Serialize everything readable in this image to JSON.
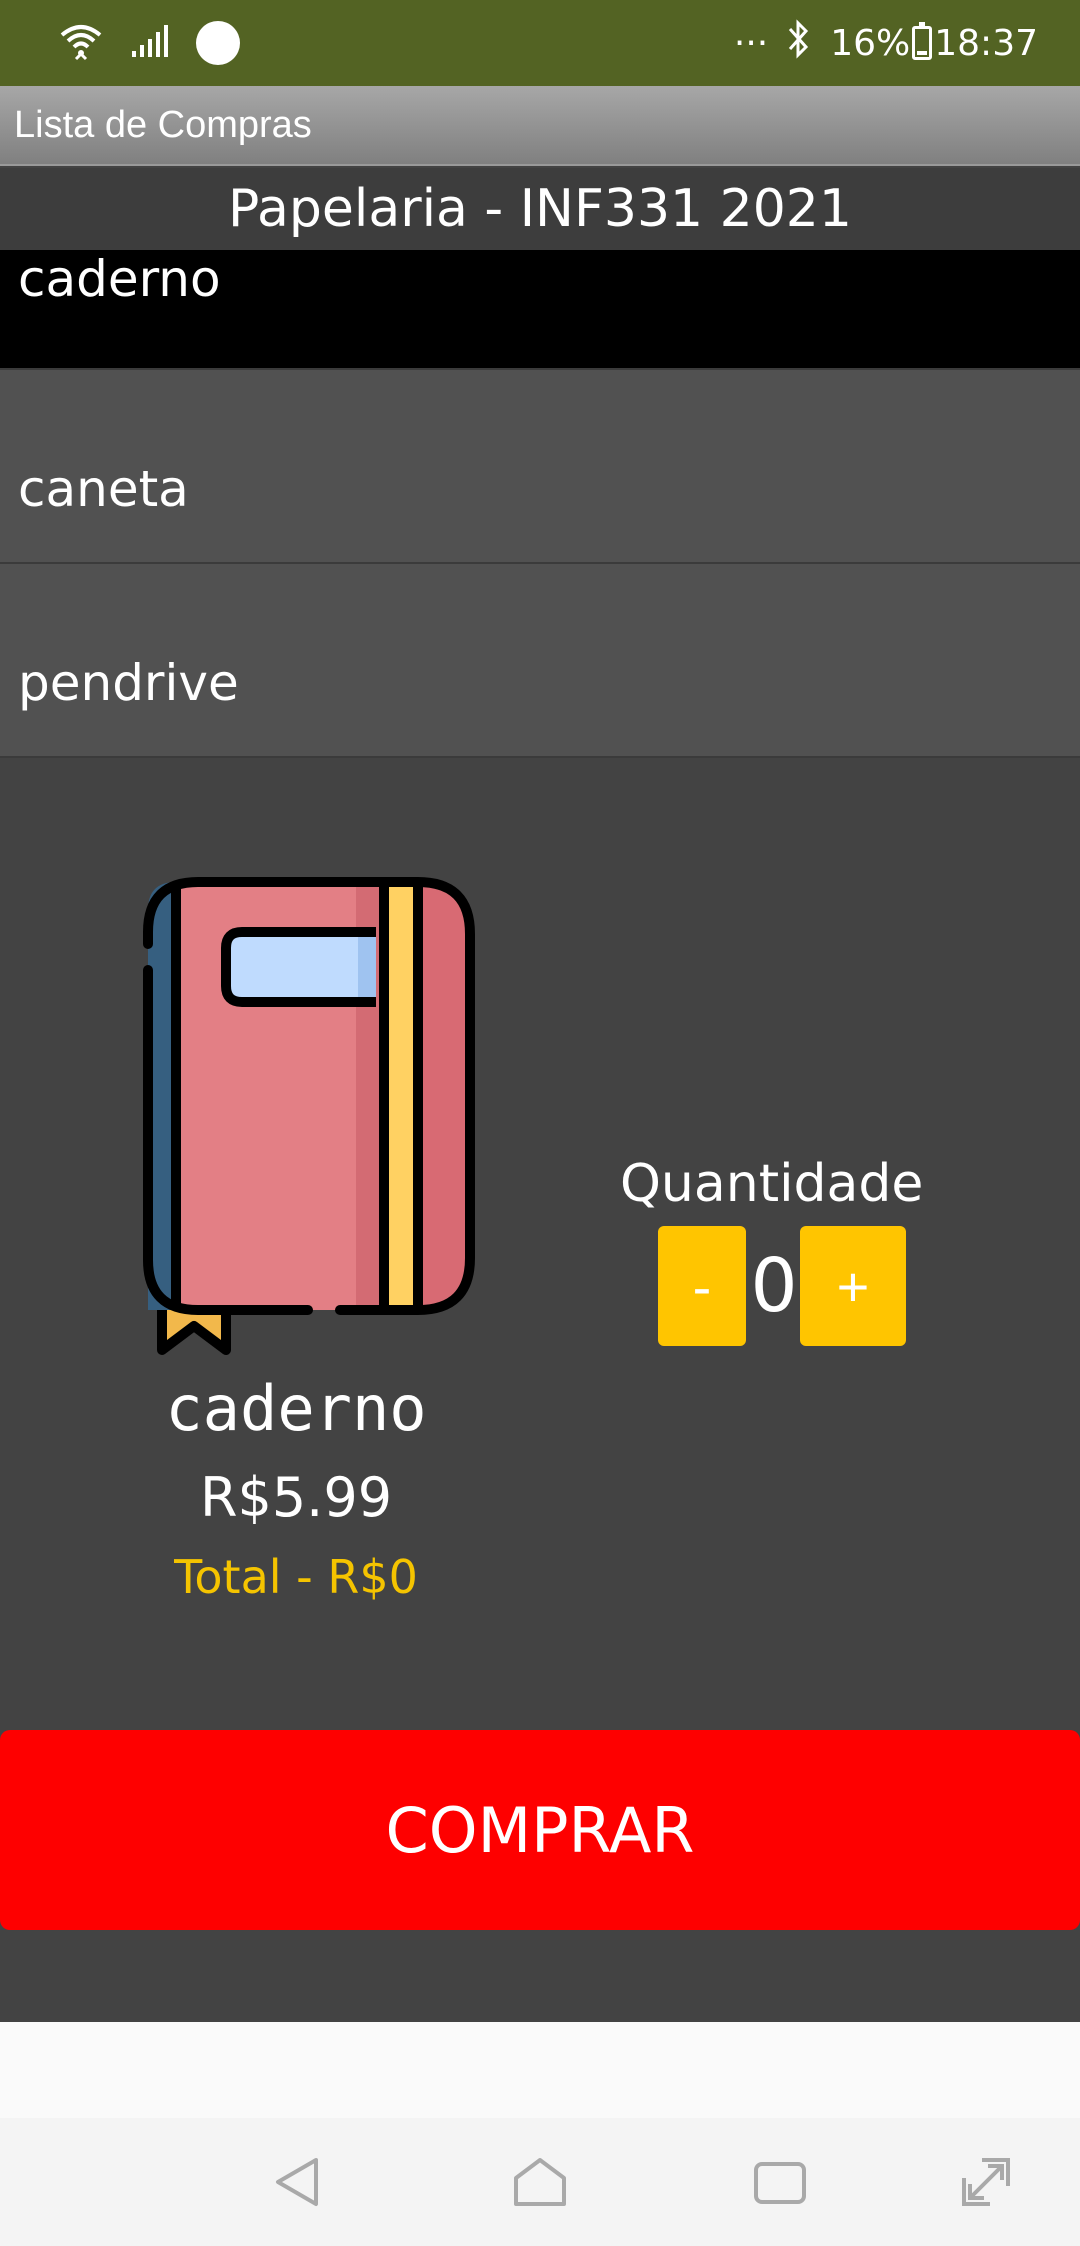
{
  "status_bar": {
    "dots": "···",
    "battery_text": "16%",
    "battery_level": 0.16,
    "time": "18:37"
  },
  "app_bar": {
    "title": "Lista de Compras"
  },
  "store": {
    "header": "Papelaria - INF331 2021"
  },
  "items": [
    {
      "label": "caderno",
      "selected": true
    },
    {
      "label": "caneta",
      "selected": false
    },
    {
      "label": "pendrive",
      "selected": false
    }
  ],
  "product": {
    "name": "caderno",
    "price": "R$5.99",
    "total": "Total - R$0",
    "image_icon": "notebook-icon"
  },
  "quantity": {
    "label": "Quantidade",
    "minus": "-",
    "value": "0",
    "plus": "+"
  },
  "buy_button": {
    "label": "COMPRAR"
  },
  "colors": {
    "status_bar": "#536323",
    "accent": "#ffc500",
    "buy": "#fe0000",
    "background": "#434343"
  }
}
